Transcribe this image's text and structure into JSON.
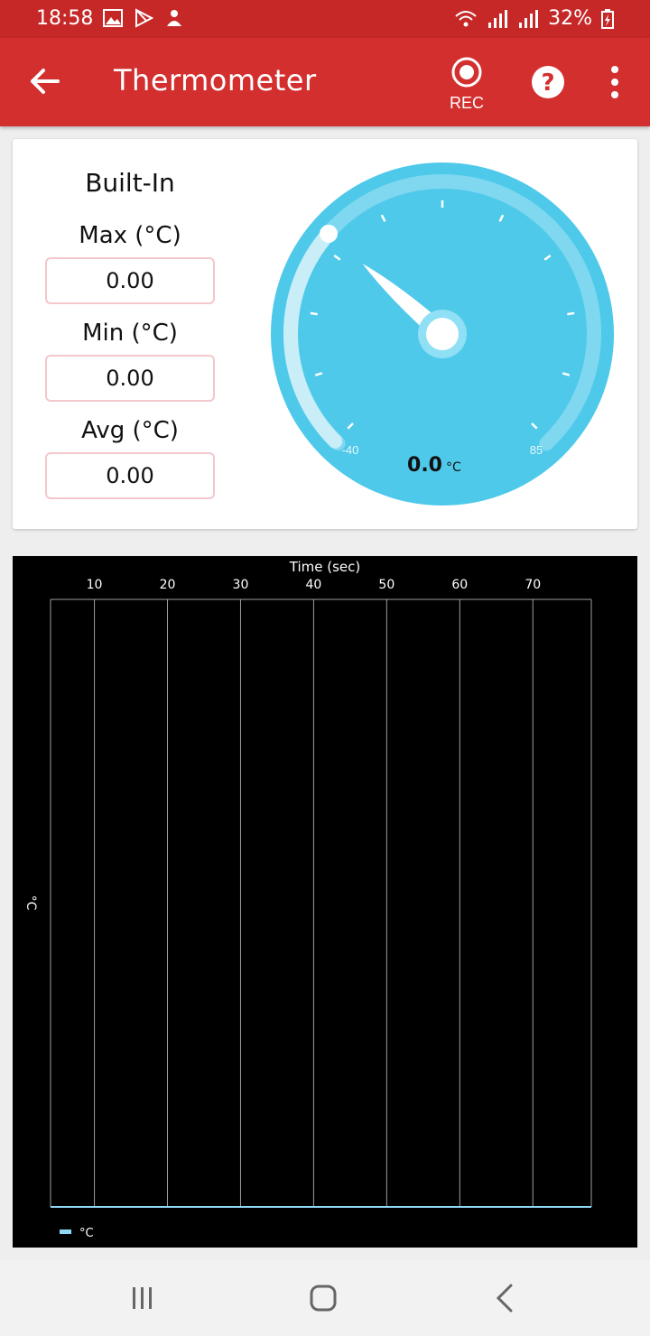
{
  "status_bar": {
    "time": "18:58",
    "battery": "32%",
    "icons": [
      "gallery-icon",
      "play-store-icon",
      "person-icon",
      "wifi-icon",
      "signal-icon",
      "signal-icon",
      "battery-icon"
    ]
  },
  "app_bar": {
    "title": "Thermometer",
    "rec_label": "REC",
    "icons": [
      "back-arrow-icon",
      "record-icon",
      "help-icon",
      "more-vert-icon"
    ],
    "color": "#d32f2f"
  },
  "sensor": {
    "name": "Built-In",
    "max_label": "Max (°C)",
    "max_value": "0.00",
    "min_label": "Min (°C)",
    "min_value": "0.00",
    "avg_label": "Avg (°C)",
    "avg_value": "0.00"
  },
  "gauge": {
    "min_label": "-40",
    "max_label": "85",
    "reading": "0.0",
    "unit": "°C",
    "value": 0,
    "range": [
      -40,
      85
    ],
    "color": "#4fc3e8"
  },
  "chart_data": {
    "type": "line",
    "title": "Time (sec)",
    "xlabel": "Time (sec)",
    "ylabel": "°C",
    "x_ticks": [
      10,
      20,
      30,
      40,
      50,
      60,
      70
    ],
    "xlim": [
      4,
      78
    ],
    "series": [
      {
        "name": "°C",
        "x": [],
        "values": []
      }
    ],
    "grid": true,
    "legend": "bottom-left",
    "series_color": "#90d8f5"
  },
  "nav": {
    "icons": [
      "recents-icon",
      "home-icon",
      "back-icon"
    ]
  }
}
